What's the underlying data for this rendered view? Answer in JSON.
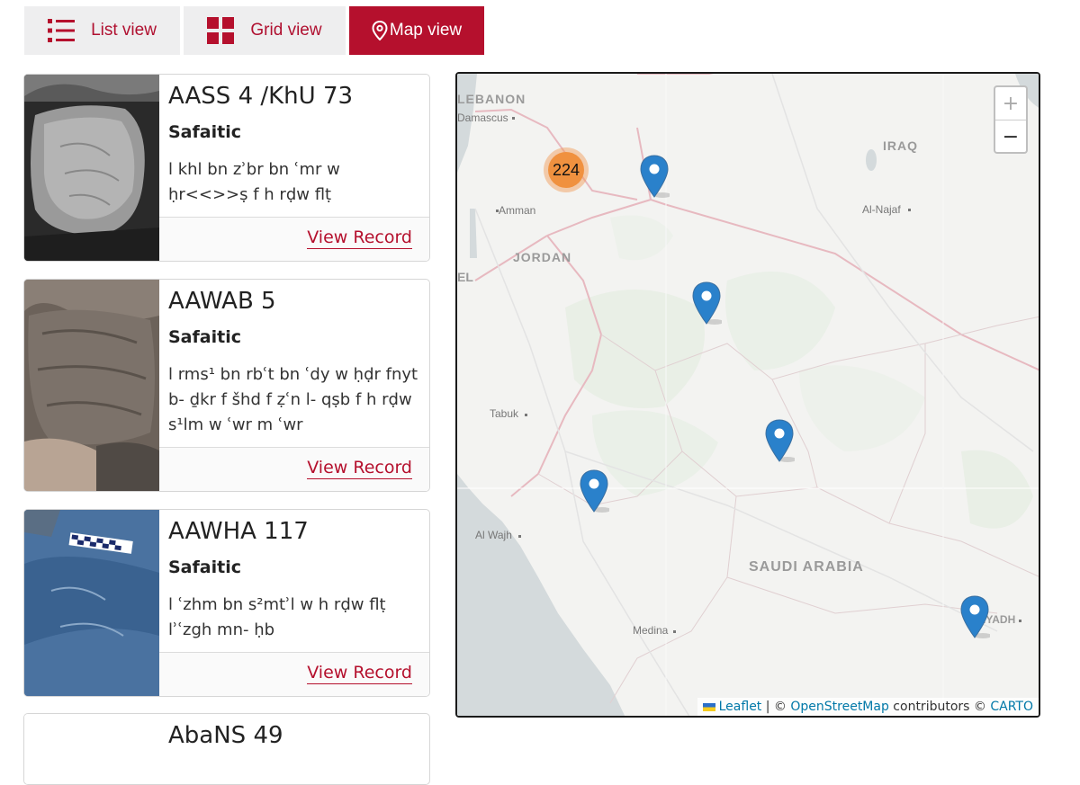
{
  "tabs": [
    {
      "label": "List view"
    },
    {
      "label": "Grid view"
    },
    {
      "label": "Map view"
    }
  ],
  "records": [
    {
      "title": "AASS 4 /KhU 73",
      "script": "Safaitic",
      "text": "l khl bn zʾbr bn ʿmr w ḥr<<>>ṣ f h rḍw flṭ",
      "link": "View Record"
    },
    {
      "title": "AAWAB 5",
      "script": "Safaitic",
      "text": "l rms¹ bn rbʿt bn ʿdy w ḥḍr fnyt b- ḏkr f šhd f ẓʿn l- qṣb f h rḍw s¹lm w ʿwr m ʿwr",
      "link": "View Record"
    },
    {
      "title": "AAWHA 117",
      "script": "Safaitic",
      "text": "l ʿzhm bn s²mtʾl w h rḍw flṭ lʾʿzgh mn- ḥb",
      "link": "View Record"
    },
    {
      "title": "AbaNS 49"
    }
  ],
  "map": {
    "labels": {
      "lebanon": "LEBANON",
      "damascus": "Damascus",
      "iraq": "IRAQ",
      "amman": "Amman",
      "al_najaf": "Al-Najaf",
      "jordan": "JORDAN",
      "el": "EL",
      "tabuk": "Tabuk",
      "al_wajh": "Al Wajh",
      "saudi_arabia": "SAUDI ARABIA",
      "medina": "Medina",
      "riyadh": "IYADH"
    },
    "cluster_count": "224",
    "zoom_in": "+",
    "zoom_out": "−",
    "attribution": {
      "leaflet": "Leaflet",
      "sep": " | © ",
      "osm": "OpenStreetMap",
      "contrib": " contributors © ",
      "carto": "CARTO"
    }
  },
  "colors": {
    "accent": "#b5102d",
    "marker": "#2a81cb",
    "cluster": "#f0883e"
  },
  "icons": {
    "list": "list-icon",
    "grid": "grid-icon",
    "map": "map-pin-icon"
  }
}
